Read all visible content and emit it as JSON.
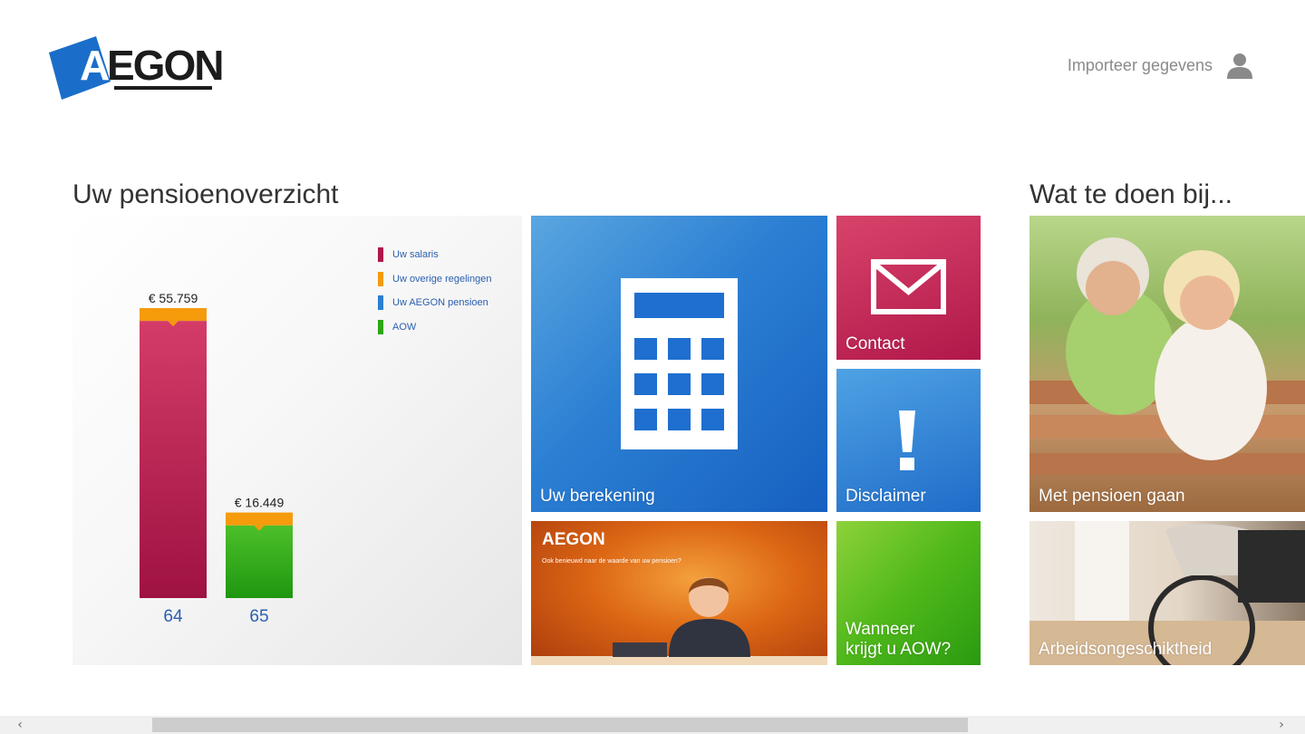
{
  "header": {
    "logo_text": "AEGON",
    "import_label": "Importeer gegevens",
    "user_icon": "user-icon"
  },
  "overview": {
    "title": "Uw pensioenoverzicht",
    "legend": [
      {
        "label": "Uw salaris",
        "color": "#b0174a"
      },
      {
        "label": "Uw overige regelingen",
        "color": "#f59b0c"
      },
      {
        "label": "Uw AEGON pensioen",
        "color": "#2b7fd3"
      },
      {
        "label": "AOW",
        "color": "#2ea514"
      }
    ]
  },
  "chart_data": {
    "type": "bar",
    "categories": [
      "64",
      "65"
    ],
    "value_labels": [
      "€ 55.759",
      "€ 16.449"
    ],
    "values": [
      55759,
      16449
    ],
    "series": [
      {
        "name": "Uw salaris",
        "color": "#b0174a",
        "values": [
          53300,
          0
        ]
      },
      {
        "name": "Uw overige regelingen",
        "color": "#f59b0c",
        "values": [
          2459,
          2459
        ]
      },
      {
        "name": "AOW",
        "color": "#2ea514",
        "values": [
          0,
          13990
        ]
      }
    ],
    "ylim": [
      0,
      57500
    ]
  },
  "tiles": {
    "calc_label": "Uw berekening",
    "contact_label": "Contact",
    "disclaimer_label": "Disclaimer",
    "promo_brand": "AEGON",
    "promo_sub": "Ook benieuwd naar de waarde van uw pensioen?",
    "aow_line1": "Wanneer",
    "aow_line2": "krijgt u AOW?"
  },
  "what_to_do": {
    "title": "Wat te doen bij...",
    "items": [
      {
        "label": "Met pensioen gaan"
      },
      {
        "label": "Arbeidsongeschiktheid"
      }
    ]
  },
  "colors": {
    "brand_blue": "#1a6ec9",
    "contact": "#c12557",
    "aow_green": "#5fbf1c",
    "promo_orange": "#dc6614"
  }
}
